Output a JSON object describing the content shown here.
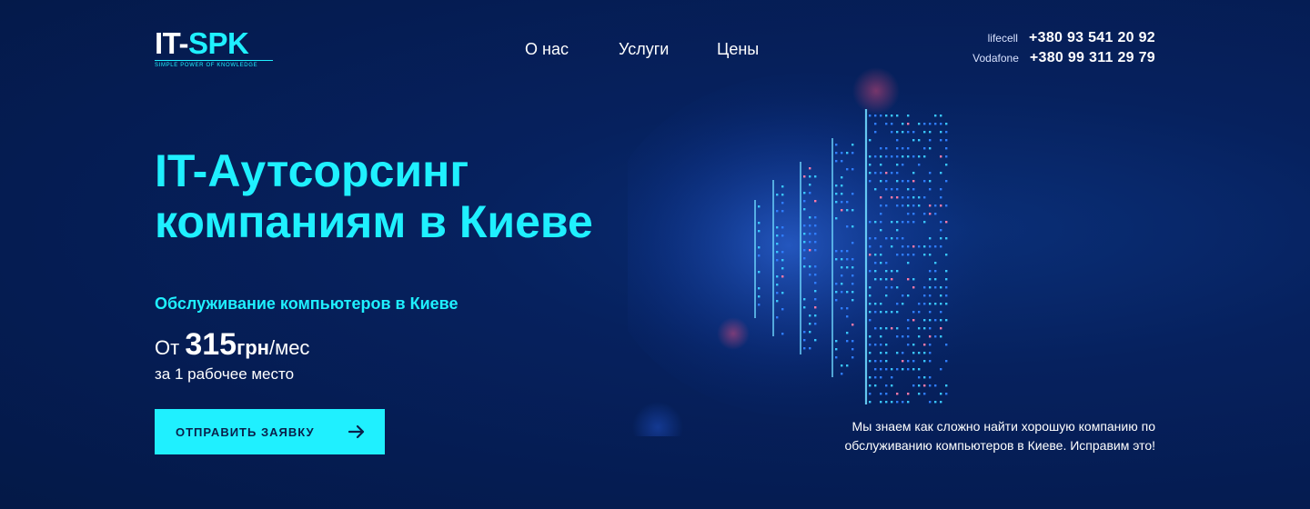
{
  "logo": {
    "text_white": "IT-",
    "text_cyan": "SPK",
    "tagline": "SIMPLE POWER OF KNOWLEDGE"
  },
  "nav": {
    "items": [
      {
        "label": "О нас"
      },
      {
        "label": "Услуги"
      },
      {
        "label": "Цены"
      }
    ]
  },
  "contacts": [
    {
      "carrier": "lifecell",
      "phone": "+380 93 541 20 92"
    },
    {
      "carrier": "Vodafone",
      "phone": "+380 99 311 29 79"
    }
  ],
  "hero": {
    "title_line1": "IT-Аутсорсинг",
    "title_line2": "компаниям в Киеве",
    "subtitle": "Обслуживание компьютеров в Киеве",
    "price_prefix": "От",
    "price_value": "315",
    "price_currency": "грн",
    "price_period": "/мес",
    "price_note": "за 1 рабочее место",
    "cta_label": "ОТПРАВИТЬ ЗАЯВКУ"
  },
  "tagline": {
    "line1": "Мы знаем как сложно найти хорошую компанию по",
    "line2": "обслуживанию компьютеров в Киеве. Исправим это!"
  },
  "icons": {
    "cta": "arrow-right-icon",
    "art": "server-rack-illustration"
  },
  "colors": {
    "accent": "#1ff0ff",
    "background": "#051c52",
    "button_text": "#0a1f4a"
  }
}
